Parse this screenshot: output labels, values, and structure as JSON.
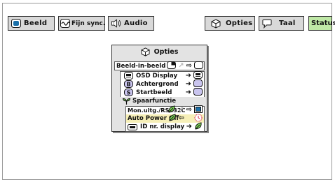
{
  "tabs": [
    {
      "label": "Beeld",
      "icon": "picture-icon"
    },
    {
      "label": "Fijn sync.",
      "icon": "fine-sync-icon"
    },
    {
      "label": "Audio",
      "icon": "speaker-icon"
    },
    {
      "label": "Opties",
      "icon": "options-cube-icon"
    },
    {
      "label": "Taal",
      "icon": "speech-bubble-icon"
    },
    {
      "label": "Status",
      "icon": ""
    }
  ],
  "menu": {
    "title": "Opties",
    "title_icon": "options-cube-icon",
    "rows": [
      {
        "label": "Beeld-in-beeld"
      },
      {
        "label": "OSD Display"
      },
      {
        "label": "Achtergrond"
      },
      {
        "label": "Startbeeld"
      },
      {
        "label": "Spaarfunctie"
      },
      {
        "label": "Mon.uitg./RS232C"
      },
      {
        "label": "Auto Power Off"
      },
      {
        "label": "ID nr. display"
      }
    ]
  },
  "colors": {
    "tab_bg": "#d9d9d9",
    "active_tab_bg": "#bfe8a6",
    "menu_bg": "#e3e3e3",
    "selected_row_bg": "#f6efb7",
    "leaf_green": "#7ed957",
    "indicator_blue": "#1a6fa8",
    "highlight_lilac": "#c9c4ee",
    "timer_red": "#d8244a"
  }
}
